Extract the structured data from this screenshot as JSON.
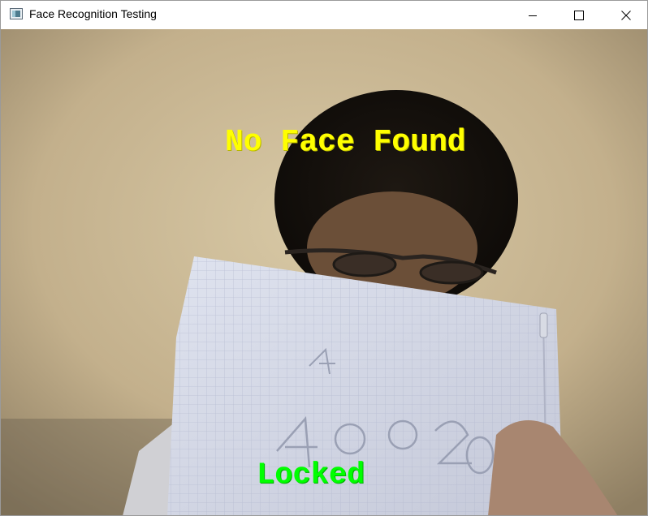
{
  "window": {
    "title": "Face Recognition Testing",
    "icons": {
      "app": "app-window-icon",
      "minimize": "minimize-icon",
      "maximize": "maximize-icon",
      "close": "close-icon"
    }
  },
  "camera": {
    "face_status": "No Face Found",
    "lock_status": "Locked",
    "status_color": "#ffff00",
    "lock_color": "#00ff00"
  }
}
